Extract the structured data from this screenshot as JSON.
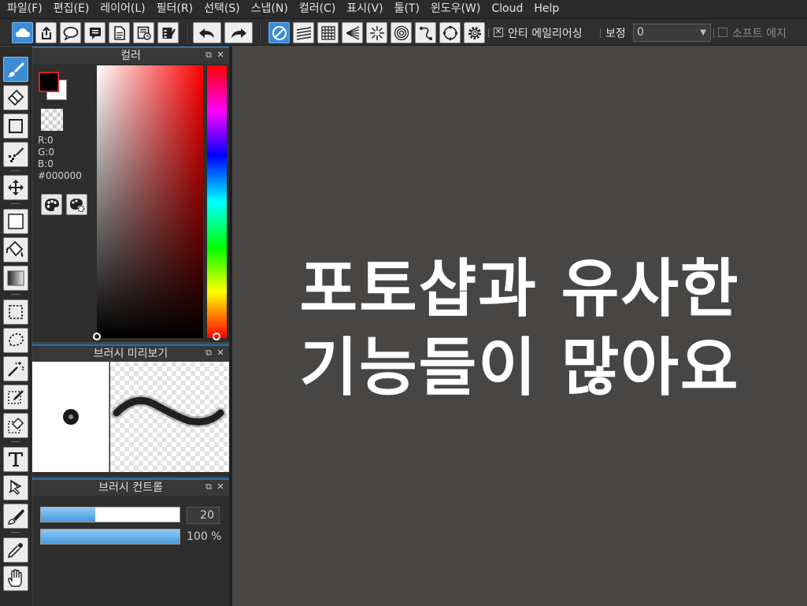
{
  "menu": [
    "파일(F)",
    "편집(E)",
    "레이어(L)",
    "필터(R)",
    "선택(S)",
    "스냅(N)",
    "컬러(C)",
    "표시(V)",
    "툴(T)",
    "윈도우(W)",
    "Cloud",
    "Help"
  ],
  "toolbar": {
    "antialias_label": "안티 에일리어싱",
    "antialias_checked": true,
    "correction_label": "보정",
    "correction_value": "0",
    "soft_edge_label": "소프트 에지",
    "soft_edge_checked": false
  },
  "color_panel": {
    "title": "컬러",
    "r": "R:0",
    "g": "G:0",
    "b": "B:0",
    "hex": "#000000",
    "fg_color": "#000000",
    "bg_color": "#ffffff",
    "hue_color": "#ff0000"
  },
  "brush_preview": {
    "title": "브러시 미리보기"
  },
  "brush_control": {
    "title": "브러시 컨트롤",
    "size_value": "20",
    "size_fraction": 0.39,
    "opacity_value": "100 %",
    "opacity_fraction": 1.0
  },
  "overlay": {
    "line1": "포토샵과 유사한",
    "line2": "기능들이 많아요"
  },
  "colors": {
    "accent": "#3b8dd6",
    "menu_bg": "#2b2b2b",
    "canvas_bg": "#474645"
  }
}
